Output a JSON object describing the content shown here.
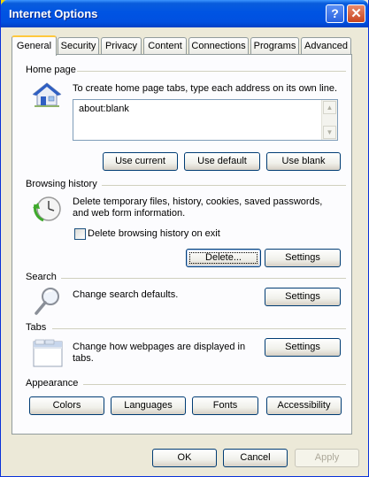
{
  "window": {
    "title": "Internet Options"
  },
  "tabs": [
    "General",
    "Security",
    "Privacy",
    "Content",
    "Connections",
    "Programs",
    "Advanced"
  ],
  "home_page": {
    "label": "Home page",
    "description": "To create home page tabs, type each address on its own line.",
    "value": "about:blank",
    "buttons": {
      "use_current": "Use current",
      "use_default": "Use default",
      "use_blank": "Use blank"
    }
  },
  "browsing_history": {
    "label": "Browsing history",
    "description_line1": "Delete temporary files, history, cookies, saved passwords,",
    "description_line2": "and web form information.",
    "checkbox_label": "Delete browsing history on exit",
    "buttons": {
      "delete": "Delete...",
      "settings": "Settings"
    }
  },
  "search": {
    "label": "Search",
    "description": "Change search defaults.",
    "settings": "Settings"
  },
  "tabs_section": {
    "label": "Tabs",
    "description_line1": "Change how webpages are displayed in",
    "description_line2": "tabs.",
    "settings": "Settings"
  },
  "appearance": {
    "label": "Appearance",
    "buttons": {
      "colors": "Colors",
      "languages": "Languages",
      "fonts": "Fonts",
      "accessibility": "Accessibility"
    }
  },
  "footer": {
    "ok": "OK",
    "cancel": "Cancel",
    "apply": "Apply"
  },
  "icons": {
    "help": "help-icon",
    "close": "close-icon",
    "home": "house-icon",
    "history": "history-clock-icon",
    "search": "magnifier-icon",
    "tabs": "tabbed-window-icon"
  },
  "colors": {
    "titlebar": "#0054e3",
    "accent_tab": "#ffc83c",
    "button_border": "#003c74"
  }
}
